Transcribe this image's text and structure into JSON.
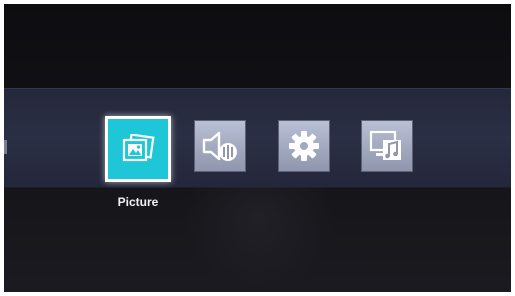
{
  "menu": {
    "items": [
      {
        "icon": "picture-icon",
        "selected": true,
        "label": "Picture"
      },
      {
        "icon": "sound-icon",
        "selected": false
      },
      {
        "icon": "settings-gear-icon",
        "selected": false
      },
      {
        "icon": "media-icon",
        "selected": false
      }
    ],
    "selected_label": "Picture"
  },
  "colors": {
    "accent": "#1fc6d8",
    "tile": "#a7adc3",
    "band": "#2b2f45",
    "background": "#0f0f12"
  }
}
